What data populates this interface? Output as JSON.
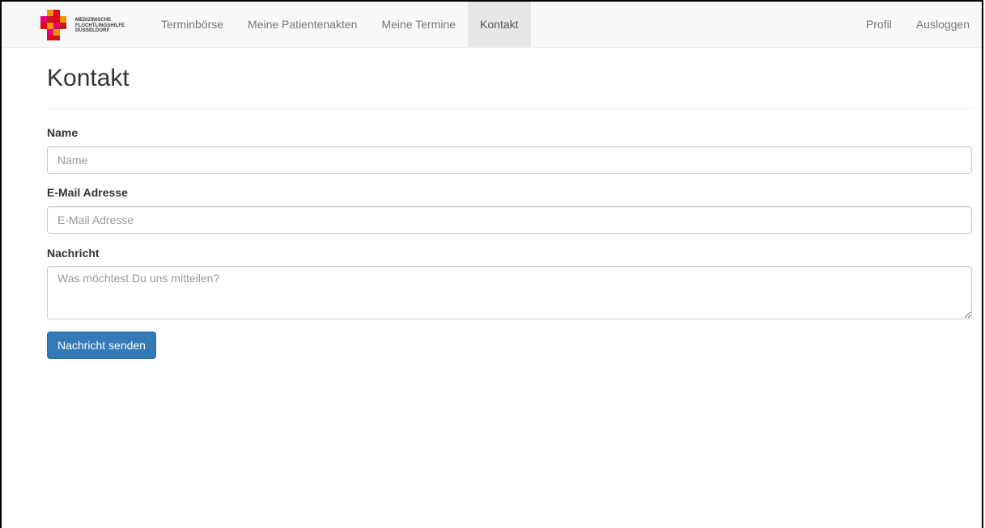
{
  "logo": {
    "lines": [
      "MEDIZINISCHE",
      "FLÜCHTLINGSHILFE",
      "DÜSSELDORF"
    ],
    "colors": [
      "#e30613",
      "#f39200",
      "#e5007d",
      "#c4161c"
    ]
  },
  "nav": {
    "left": [
      {
        "label": "Terminbörse"
      },
      {
        "label": "Meine Patientenakten"
      },
      {
        "label": "Meine Termine"
      },
      {
        "label": "Kontakt",
        "active": true
      }
    ],
    "right": [
      {
        "label": "Profil"
      },
      {
        "label": "Ausloggen"
      }
    ]
  },
  "page": {
    "title": "Kontakt"
  },
  "form": {
    "name_label": "Name",
    "name_placeholder": "Name",
    "name_value": "",
    "email_label": "E-Mail Adresse",
    "email_placeholder": "E-Mail Adresse",
    "email_value": "",
    "message_label": "Nachricht",
    "message_placeholder": "Was möchtest Du uns mitteilen?",
    "message_value": "",
    "submit_label": "Nachricht senden"
  },
  "colors": {
    "primary": "#337ab7",
    "navbar_bg": "#f8f8f8",
    "active_tab_bg": "#e7e7e7"
  }
}
